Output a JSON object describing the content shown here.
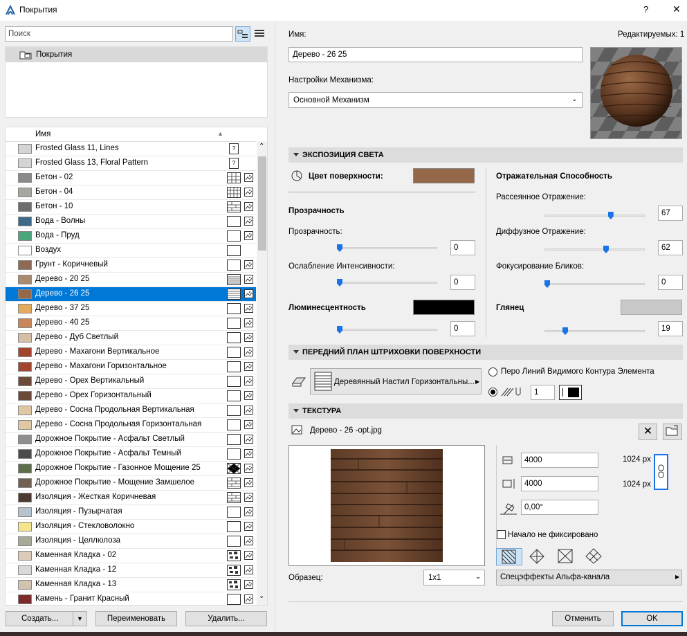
{
  "window": {
    "title": "Покрытия",
    "help": "?",
    "close": "✕"
  },
  "left": {
    "search_placeholder": "Поиск",
    "tree_root": "Покрытия",
    "list_header": "Имя",
    "items": [
      {
        "name": "Frosted Glass 11, Lines",
        "color": "#d4d4d4",
        "pattern": "?",
        "img": ""
      },
      {
        "name": "Frosted Glass 13, Floral Pattern",
        "color": "#d4d4d4",
        "pattern": "?",
        "img": ""
      },
      {
        "name": "Бетон - 02",
        "color": "#8a8a8a",
        "pattern": "grid",
        "img": "img"
      },
      {
        "name": "Бетон - 04",
        "color": "#a7a7a0",
        "pattern": "grid2",
        "img": "img"
      },
      {
        "name": "Бетон - 10",
        "color": "#6e6e6e",
        "pattern": "brick",
        "img": "img"
      },
      {
        "name": "Вода - Волны",
        "color": "#3d6a87",
        "pattern": "",
        "img": "img"
      },
      {
        "name": "Вода - Пруд",
        "color": "#4aa57a",
        "pattern": "",
        "img": "img"
      },
      {
        "name": "Воздух",
        "color": "#ffffff",
        "pattern": "",
        "img": ""
      },
      {
        "name": "Грунт - Коричневый",
        "color": "#8e6a52",
        "pattern": "",
        "img": "img"
      },
      {
        "name": "Дерево - 20 25",
        "color": "#a98b6f",
        "pattern": "lines",
        "img": "img"
      },
      {
        "name": "Дерево - 26 25",
        "color": "#95684a",
        "pattern": "lines",
        "img": "img",
        "selected": true
      },
      {
        "name": "Дерево - 37 25",
        "color": "#e3ab5c",
        "pattern": "",
        "img": "img"
      },
      {
        "name": "Дерево - 40 25",
        "color": "#c8865b",
        "pattern": "",
        "img": "img"
      },
      {
        "name": "Дерево - Дуб Светлый",
        "color": "#d5c0a5",
        "pattern": "",
        "img": "img"
      },
      {
        "name": "Дерево - Махагони Вертикальное",
        "color": "#a3452e",
        "pattern": "",
        "img": "img"
      },
      {
        "name": "Дерево - Махагони Горизонтальное",
        "color": "#a3452e",
        "pattern": "",
        "img": "img"
      },
      {
        "name": "Дерево - Орех Вертикальный",
        "color": "#6b4a37",
        "pattern": "",
        "img": "img"
      },
      {
        "name": "Дерево - Орех Горизонтальный",
        "color": "#6b4a37",
        "pattern": "",
        "img": "img"
      },
      {
        "name": "Дерево - Сосна Продольная Вертикальная",
        "color": "#e0c7a3",
        "pattern": "",
        "img": "img"
      },
      {
        "name": "Дерево - Сосна Продольная Горизонтальная",
        "color": "#e0c7a3",
        "pattern": "",
        "img": "img"
      },
      {
        "name": "Дорожное Покрытие - Асфальт Светлый",
        "color": "#8e8e8e",
        "pattern": "",
        "img": "img"
      },
      {
        "name": "Дорожное Покрытие - Асфальт Темный",
        "color": "#4b4b4b",
        "pattern": "",
        "img": "img"
      },
      {
        "name": "Дорожное Покрытие - Газонное Мощение 25",
        "color": "#5e6d4a",
        "pattern": "cross",
        "img": "img"
      },
      {
        "name": "Дорожное Покрытие - Мощение Замшелое",
        "color": "#706050",
        "pattern": "brick",
        "img": "img"
      },
      {
        "name": "Изоляция - Жесткая Коричневая",
        "color": "#4a3a32",
        "pattern": "brick",
        "img": "img"
      },
      {
        "name": "Изоляция - Пузырчатая",
        "color": "#b7c4cd",
        "pattern": "",
        "img": "img"
      },
      {
        "name": "Изоляция - Стекловолокно",
        "color": "#f5e38d",
        "pattern": "",
        "img": "img"
      },
      {
        "name": "Изоляция - Целлюлоза",
        "color": "#a8aa98",
        "pattern": "",
        "img": "img"
      },
      {
        "name": "Каменная Кладка - 02",
        "color": "#ddcbb9",
        "pattern": "stone",
        "img": "img"
      },
      {
        "name": "Каменная Кладка - 12",
        "color": "#d9d9d9",
        "pattern": "stone",
        "img": "img"
      },
      {
        "name": "Каменная Кладка - 13",
        "color": "#d2c3b1",
        "pattern": "stone",
        "img": "img"
      },
      {
        "name": "Камень - Гранит Красный",
        "color": "#7a2a2a",
        "pattern": "",
        "img": "img"
      }
    ],
    "buttons": {
      "create": "Создать...",
      "rename": "Переименовать",
      "delete": "Удалить..."
    }
  },
  "right": {
    "name_label": "Имя:",
    "editable": "Редактируемых: 1",
    "name_value": "Дерево - 26 25",
    "engine_label": "Настройки Механизма:",
    "engine_value": "Основной Механизм",
    "section_light": "ЭКСПОЗИЦИЯ СВЕТА",
    "surface_color_label": "Цвет поверхности:",
    "surface_color": "#95684a",
    "transparency_hdr": "Прозрачность",
    "transparency_label": "Прозрачность:",
    "transparency_value": "0",
    "transparency_level": 0,
    "falloff_label": "Ослабление Интенсивности:",
    "falloff_value": "0",
    "falloff_level": 0,
    "luminance_label": "Люминесцентность",
    "luminance_color": "#000000",
    "luminance_value": "0",
    "luminance_level": 0,
    "reflect_hdr": "Отражательная Способность",
    "ambient_label": "Рассеянное Отражение:",
    "ambient_value": "67",
    "ambient_level": 67,
    "diffuse_label": "Диффузное Отражение:",
    "diffuse_value": "62",
    "diffuse_level": 62,
    "specular_label": "Фокусирование Бликов:",
    "specular_value": "0",
    "specular_level": 0,
    "gloss_label": "Глянец",
    "gloss_color": "#c8c8c8",
    "gloss_value": "19",
    "gloss_level": 19,
    "section_hatch": "ПЕРЕДНИЙ ПЛАН ШТРИХОВКИ ПОВЕРХНОСТИ",
    "hatch_name": "Деревянный Настил Горизонтальны...",
    "radio_pen_label": "Перо Линий Видимого Контура Элемента",
    "pen_value": "1",
    "section_texture": "ТЕКСТУРА",
    "texture_file": "Дерево - 26 -opt.jpg",
    "tex_width": "4000",
    "tex_height": "4000",
    "tex_angle": "0,00°",
    "px_w": "1024 px",
    "px_h": "1024 px",
    "origin_label": "Начало не фиксировано",
    "sample_label": "Образец:",
    "sample_value": "1x1",
    "alpha_label": "Спецэффекты Альфа-канала",
    "cancel": "Отменить",
    "ok": "OK"
  }
}
